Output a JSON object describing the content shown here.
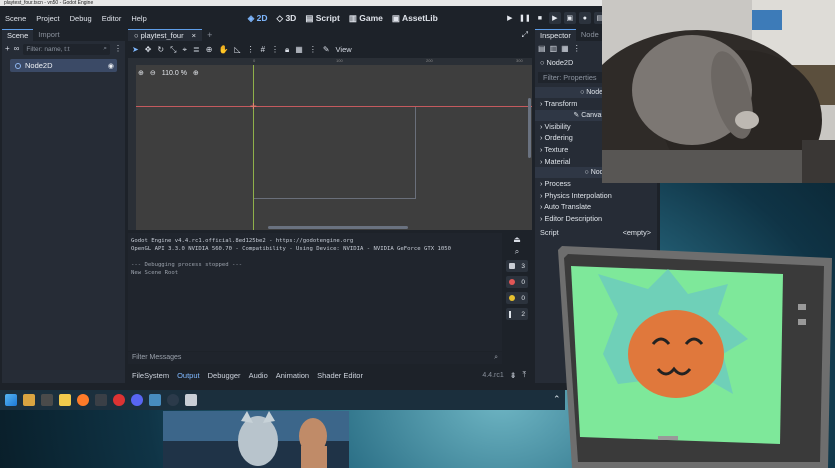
{
  "window": {
    "title": "playtest_four.tscn - vn50 - Godot Engine"
  },
  "menu": [
    "Scene",
    "Project",
    "Debug",
    "Editor",
    "Help"
  ],
  "modes": [
    {
      "label": "2D",
      "active": true
    },
    {
      "label": "3D",
      "active": false
    },
    {
      "label": "Script",
      "active": false
    },
    {
      "label": "Game",
      "active": false
    },
    {
      "label": "AssetLib",
      "active": false
    }
  ],
  "scene_dock": {
    "tabs": [
      "Scene",
      "Import"
    ],
    "filter_placeholder": "Filter: name, t:t",
    "root_node": "Node2D"
  },
  "scene_tabs": [
    "playtest_four"
  ],
  "viewport": {
    "view_label": "View",
    "zoom": "110.0 %",
    "ruler_marks": [
      "0",
      "100",
      "200",
      "300"
    ]
  },
  "output": {
    "lines": [
      "Godot Engine v4.4.rc1.official.8ed125be2 - https://godotengine.org",
      "OpenGL API 3.3.0 NVIDIA 560.70 - Compatibility - Using Device: NVIDIA - NVIDIA GeForce GTX 1050",
      "",
      "--- Debugging process stopped ---",
      "New Scene Root"
    ],
    "counts": {
      "messages": "3",
      "errors": "0",
      "warnings": "0",
      "info": "2"
    },
    "filter_placeholder": "Filter Messages"
  },
  "bottom_tabs": [
    {
      "label": "FileSystem",
      "active": false
    },
    {
      "label": "Output",
      "active": true
    },
    {
      "label": "Debugger",
      "active": false
    },
    {
      "label": "Audio",
      "active": false
    },
    {
      "label": "Animation",
      "active": false
    },
    {
      "label": "Shader Editor",
      "active": false
    }
  ],
  "version": "4.4.rc1",
  "inspector": {
    "tabs": [
      "Inspector",
      "Node"
    ],
    "node_name": "Node2D",
    "filter_placeholder": "Filter: Properties",
    "section_node2d": "Node2D",
    "transform": "Transform",
    "section_canvas": "CanvasItem",
    "visibility": "Visibility",
    "ordering": "Ordering",
    "texture": "Texture",
    "material": "Material",
    "section_node": "Node",
    "process": "Process",
    "physics": "Physics Interpolation",
    "auto_translate": "Auto Translate",
    "editor_description": "Editor Description",
    "script_label": "Script",
    "script_value": "<empty>"
  },
  "colors": {
    "accent": "#5f9ee8",
    "editor_bg": "#1d2229",
    "panel_bg": "#262c36",
    "x_axis": "#c55a5e",
    "y_axis": "#8fb04a",
    "error": "#e15656",
    "warning": "#e6c02f",
    "vtuber_screen": "#7ee89a",
    "vtuber_face": "#e0783c"
  }
}
